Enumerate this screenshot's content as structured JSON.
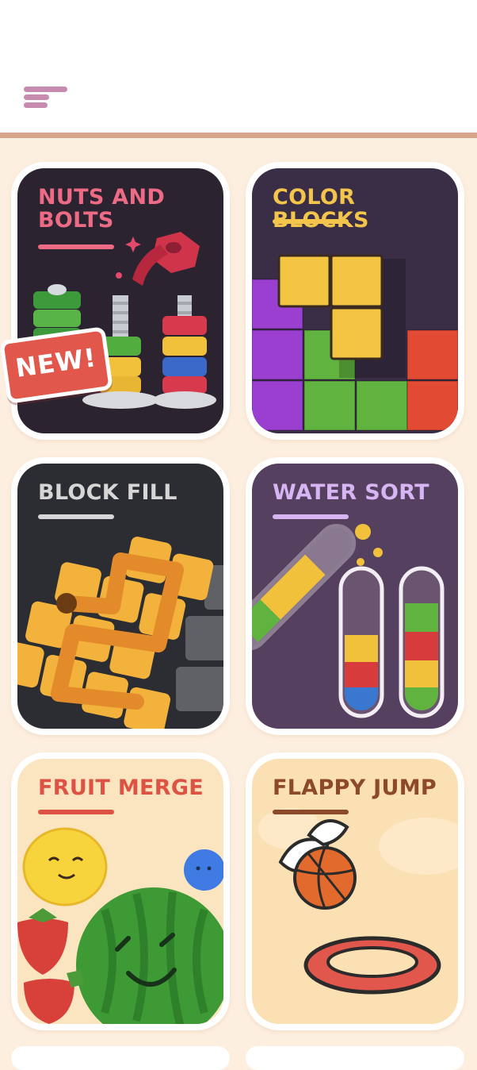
{
  "header": {
    "menu_icon": "hamburger-menu-icon"
  },
  "badge": {
    "label": "NEW!"
  },
  "colors": {
    "header_bg": "#ffffff",
    "header_border": "#d9a58c",
    "page_bg": "#fdefdf",
    "menu_icon": "#c88bb0",
    "badge": "#e2574c"
  },
  "games": [
    {
      "title": "NUTS AND\nBOLTS",
      "title_color": "#ee6b86",
      "bg": "#2b2430"
    },
    {
      "title": "COLOR BLOCKS",
      "title_color": "#f3c54c",
      "bg": "#3a2d46"
    },
    {
      "title": "BLOCK FILL",
      "title_color": "#d6d6d6",
      "bg": "#2b2d33"
    },
    {
      "title": "WATER SORT",
      "title_color": "#d7b5f2",
      "bg": "#55405f"
    },
    {
      "title": "FRUIT MERGE",
      "title_color": "#dd5243",
      "bg": "#fbe5c1"
    },
    {
      "title": "FLAPPY JUMP",
      "title_color": "#8c4a2a",
      "bg": "#fbe0b3"
    }
  ]
}
